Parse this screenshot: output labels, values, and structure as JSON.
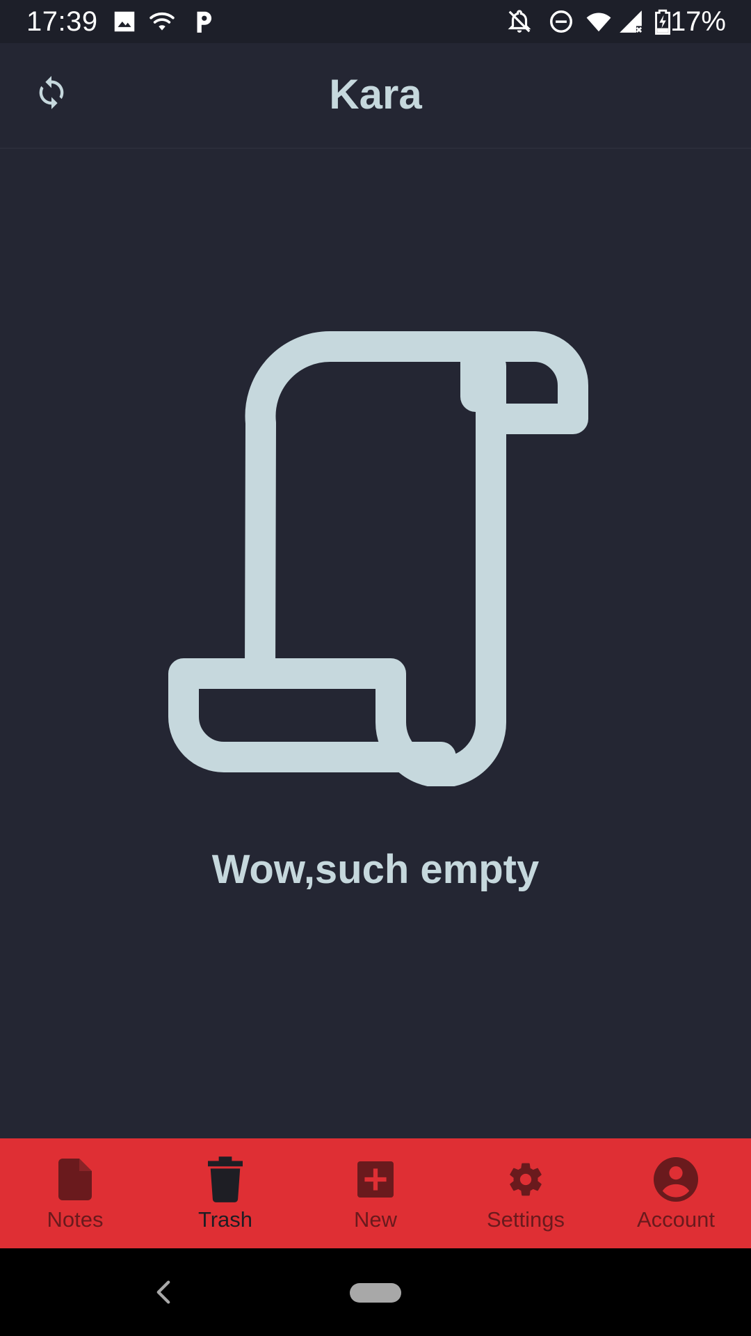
{
  "status_bar": {
    "time": "17:39",
    "battery": "17%",
    "left_icons": [
      "image-icon",
      "wifi-icon",
      "parking-icon"
    ],
    "right_icons": [
      "notifications-off-icon",
      "do-not-disturb-icon",
      "wifi-icon",
      "signal-icon",
      "battery-charging-icon"
    ]
  },
  "app_bar": {
    "title": "Kara",
    "sync_icon": "sync-icon"
  },
  "empty_state": {
    "message": "Wow,such empty",
    "illustration": "scroll-icon"
  },
  "bottom_nav": {
    "active": "trash",
    "items": [
      {
        "id": "notes",
        "label": "Notes",
        "icon": "note-icon"
      },
      {
        "id": "trash",
        "label": "Trash",
        "icon": "trash-icon"
      },
      {
        "id": "new",
        "label": "New",
        "icon": "add-box-icon"
      },
      {
        "id": "settings",
        "label": "Settings",
        "icon": "gear-icon"
      },
      {
        "id": "account",
        "label": "Account",
        "icon": "account-circle-icon"
      }
    ]
  },
  "colors": {
    "background": "#242633",
    "status_bar": "#1d1f29",
    "accent_text": "#c6d8dd",
    "nav_background": "#df2f34",
    "nav_inactive": "#6a1a1d",
    "nav_active": "#1e1e24"
  }
}
